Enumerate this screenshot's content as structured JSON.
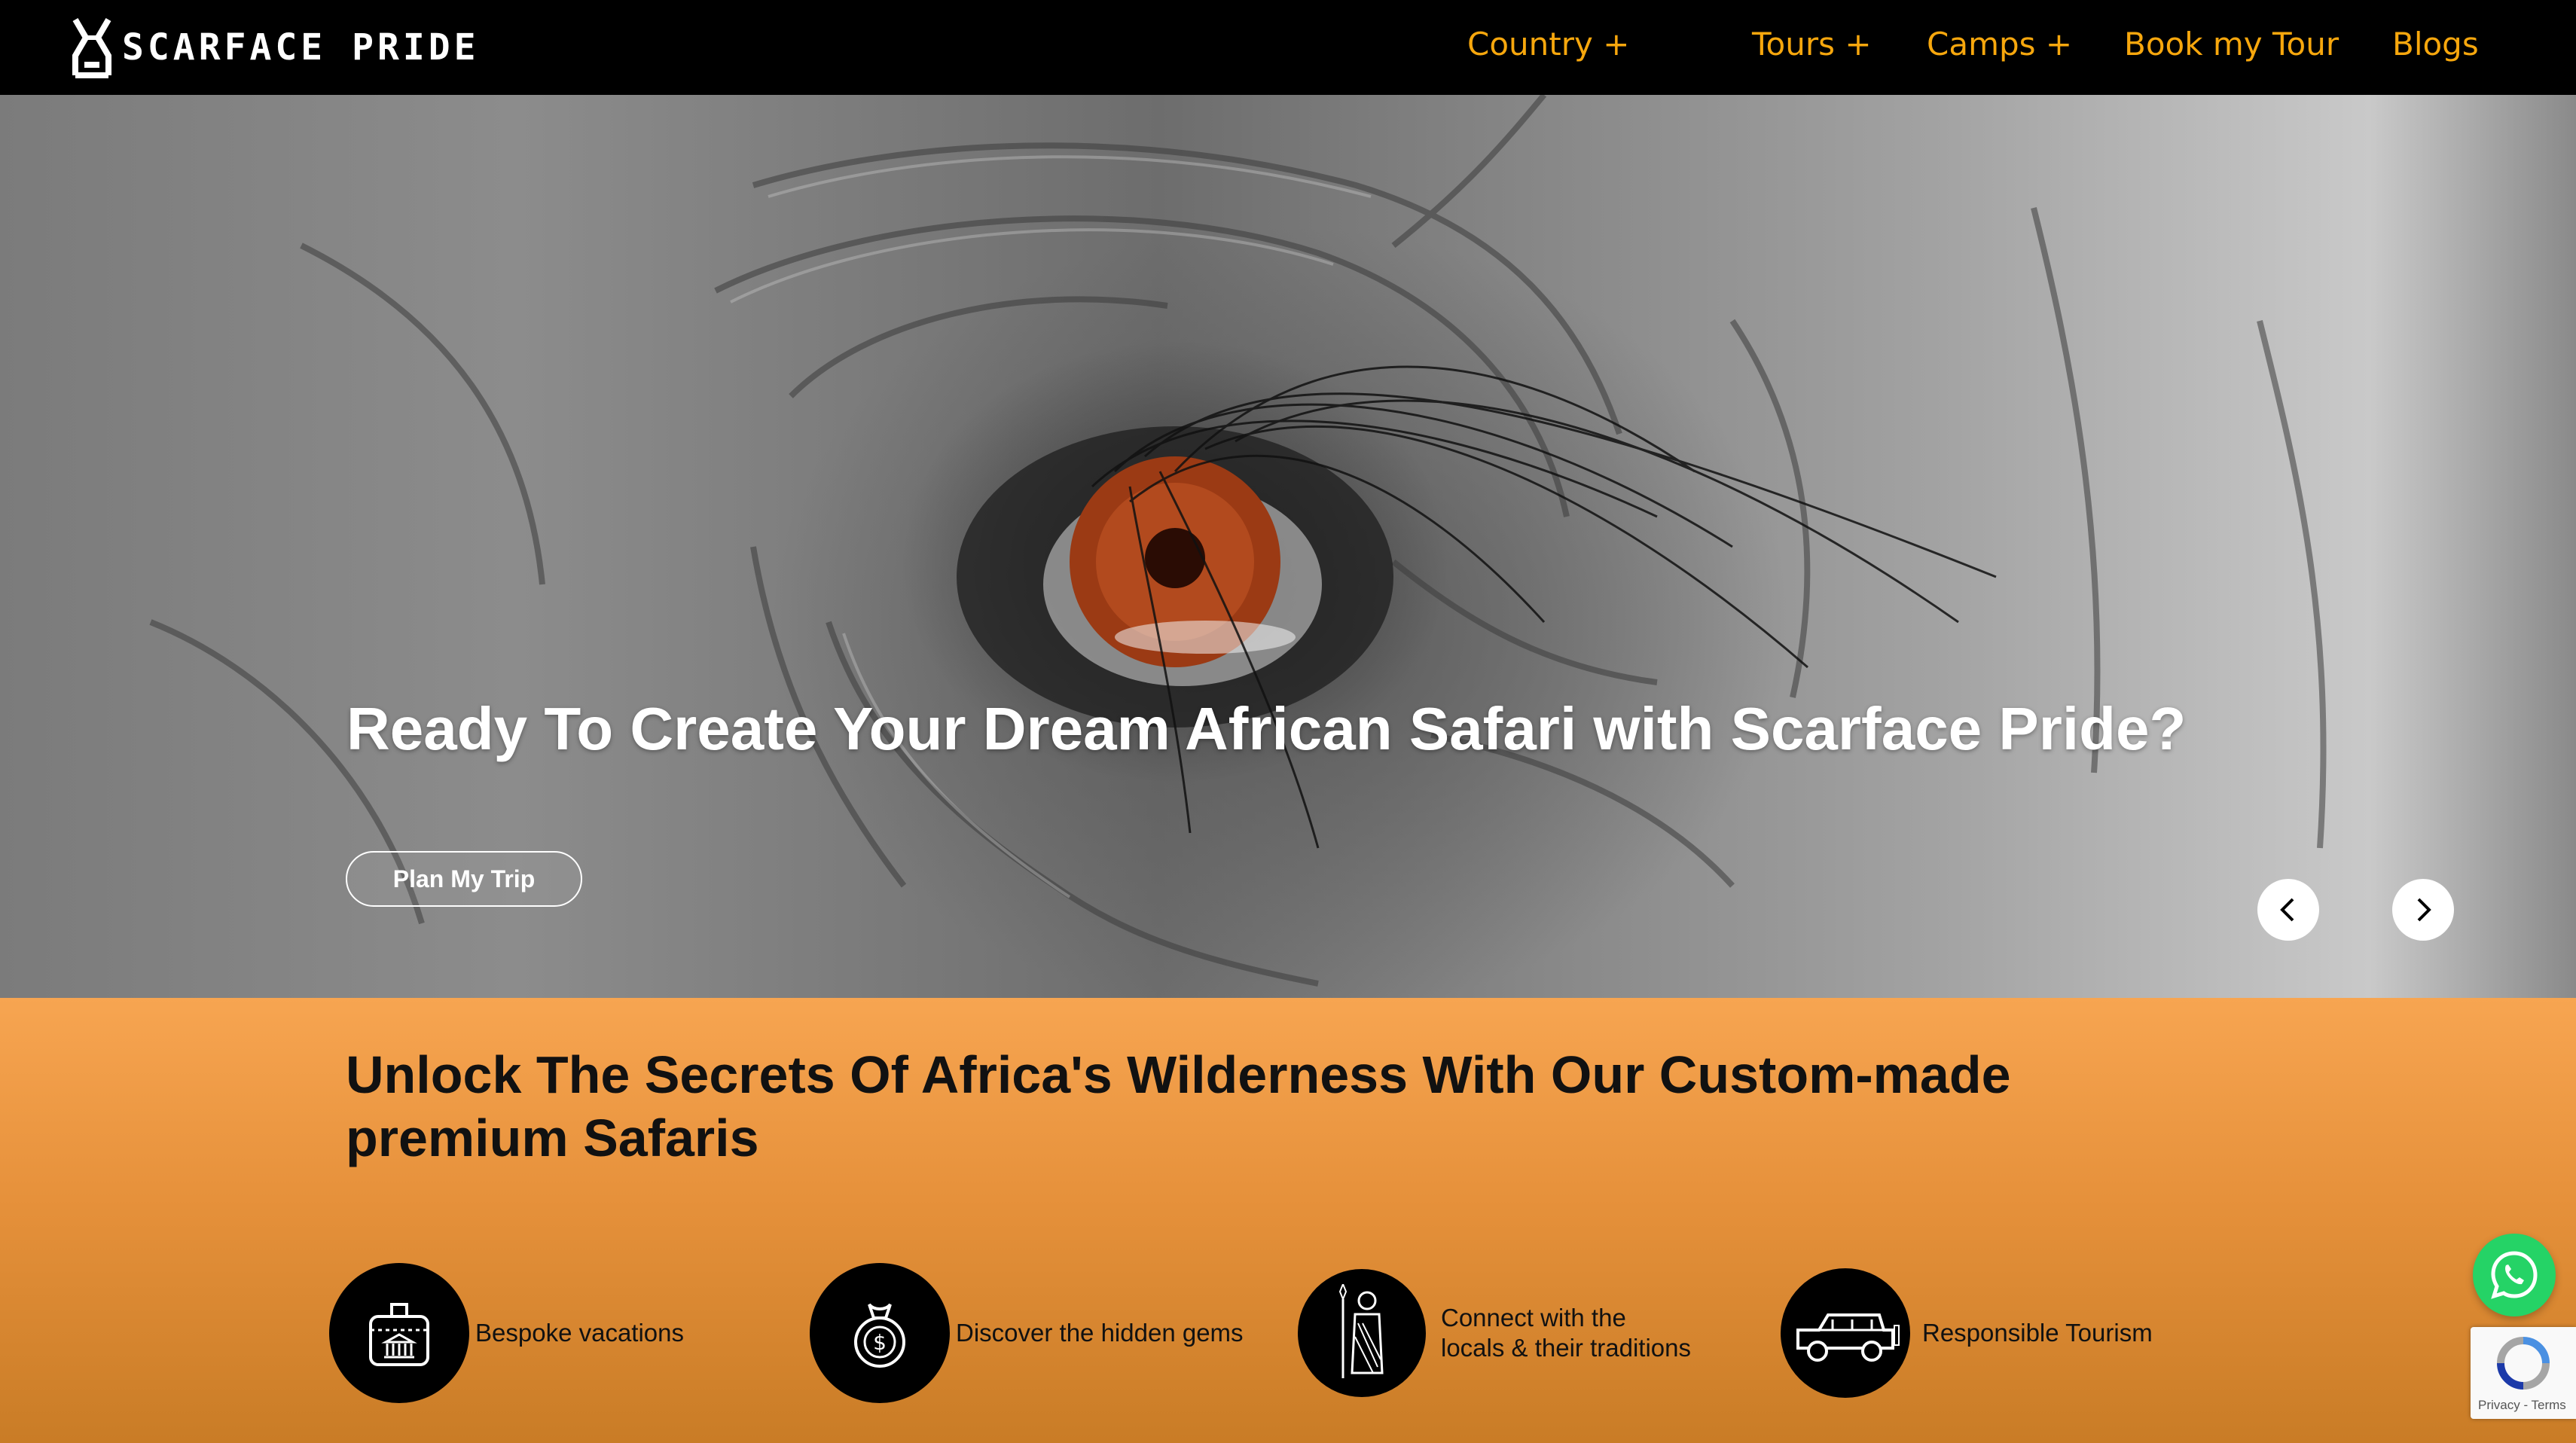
{
  "brand": {
    "name": "SCARFACE PRIDE"
  },
  "nav": {
    "items": [
      {
        "label": "Country +"
      },
      {
        "label": "Tours +"
      },
      {
        "label": "Camps +"
      },
      {
        "label": "Book my Tour"
      },
      {
        "label": "Blogs"
      }
    ]
  },
  "hero": {
    "title": "Ready To Create Your Dream African Safari with Scarface Pride?",
    "cta": "Plan My Trip",
    "prev_icon": "chevron-left-icon",
    "next_icon": "chevron-right-icon"
  },
  "features": {
    "heading": "Unlock The Secrets Of Africa's Wilderness With Our Custom-made premium Safaris",
    "items": [
      {
        "label": "Bespoke vacations",
        "icon": "suitcase-bank-icon"
      },
      {
        "label": "Discover the hidden gems",
        "icon": "money-bag-icon"
      },
      {
        "label_line1": "Connect with the",
        "label_line2": "locals & their traditions",
        "icon": "tribal-person-icon"
      },
      {
        "label": "Responsible Tourism",
        "icon": "safari-jeep-icon"
      }
    ]
  },
  "widgets": {
    "whatsapp_icon": "whatsapp-icon",
    "recaptcha_text": "Privacy - Terms"
  },
  "colors": {
    "nav_bg": "#000000",
    "nav_link": "#f7a70d",
    "section_orange_top": "#f7a551",
    "section_orange_bottom": "#c97c26",
    "whatsapp_green": "#25d366",
    "eye_iris": "#9b3a14"
  }
}
